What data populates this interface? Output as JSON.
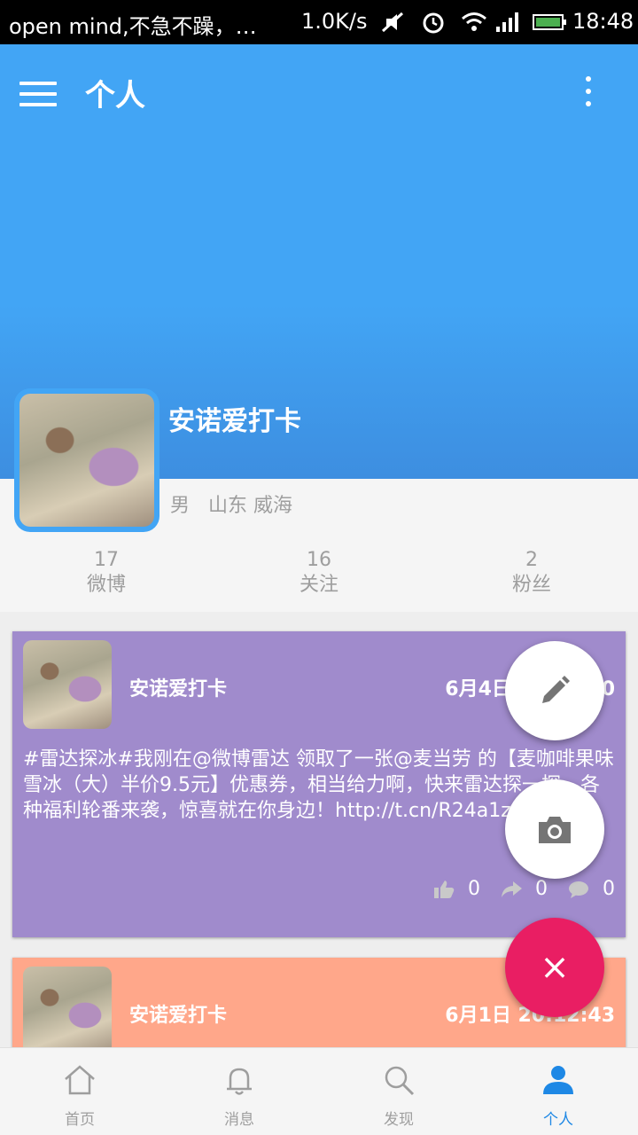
{
  "status_bar": {
    "notification": "open mind,不急不躁，…",
    "speed": "1.0K/s",
    "time": "18:48"
  },
  "toolbar": {
    "title": "个人"
  },
  "profile": {
    "username": "安诺爱打卡",
    "gender": "男",
    "location": "山东 威海",
    "stats": [
      {
        "count": "17",
        "label": "微博"
      },
      {
        "count": "16",
        "label": "关注"
      },
      {
        "count": "2",
        "label": "粉丝"
      }
    ]
  },
  "posts": [
    {
      "name": "安诺爱打卡",
      "date": "6月4日 20:14:40",
      "text": "#雷达探冰#我刚在@微博雷达 领取了一张@麦当劳 的【麦咖啡果味雪冰（大）半价9.5元】优惠券，相当给力啊，快来雷达探一探，各种福利轮番来袭，惊喜就在你身边！http://t.cn/R24a1z4",
      "likes": "0",
      "reposts": "0",
      "comments": "0",
      "color": "#a08bcc"
    },
    {
      "name": "安诺爱打卡",
      "date": "6月1日 20:12:43",
      "color": "#ffa78a"
    }
  ],
  "fab": {
    "close_symbol": "×"
  },
  "bottom_nav": [
    {
      "label": "首页",
      "icon": "home-icon"
    },
    {
      "label": "消息",
      "icon": "bell-icon"
    },
    {
      "label": "发现",
      "icon": "search-icon"
    },
    {
      "label": "个人",
      "icon": "person-icon"
    }
  ],
  "colors": {
    "primary": "#42a5f5",
    "accent": "#e91e63",
    "active_nav": "#1e88e5"
  }
}
